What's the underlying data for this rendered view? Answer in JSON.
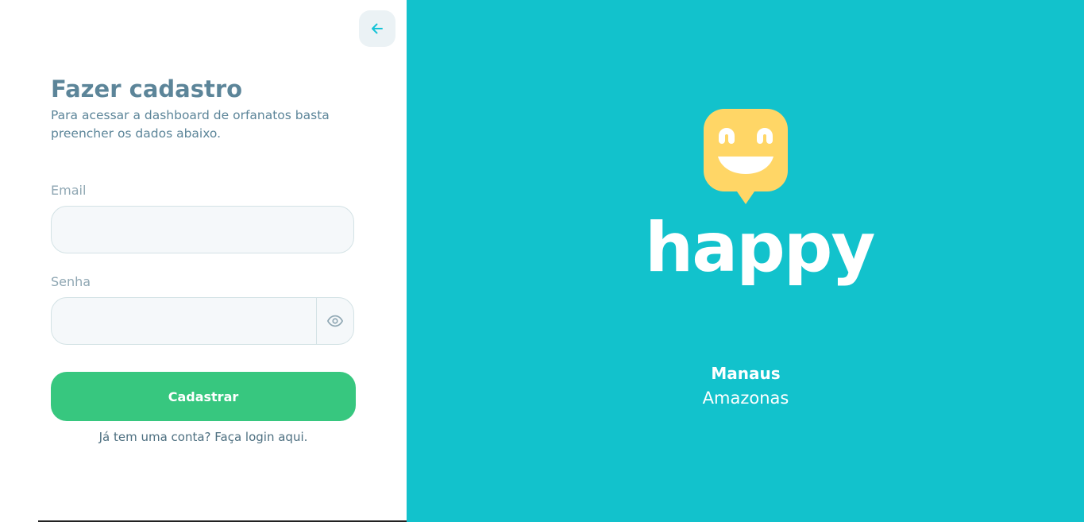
{
  "back_button": {
    "icon": "arrow-left-icon",
    "color": "#15c3d6"
  },
  "form": {
    "title": "Fazer cadastro",
    "subtitle": "Para acessar a dashboard de orfanatos basta preencher os dados abaixo.",
    "email": {
      "label": "Email",
      "value": "",
      "placeholder": ""
    },
    "password": {
      "label": "Senha",
      "value": "",
      "placeholder": "",
      "toggle_icon": "eye-icon"
    },
    "submit_label": "Cadastrar",
    "login_link": "Já tem uma conta? Faça login aqui."
  },
  "brand": {
    "name": "happy",
    "logo_icon": "smiley-chat-bubble-icon",
    "city": "Manaus",
    "state": "Amazonas"
  },
  "colors": {
    "brand_background": "#12c2cc",
    "logo_yellow": "#ffd666",
    "primary_button": "#37c77f",
    "text": "#5c8599"
  }
}
